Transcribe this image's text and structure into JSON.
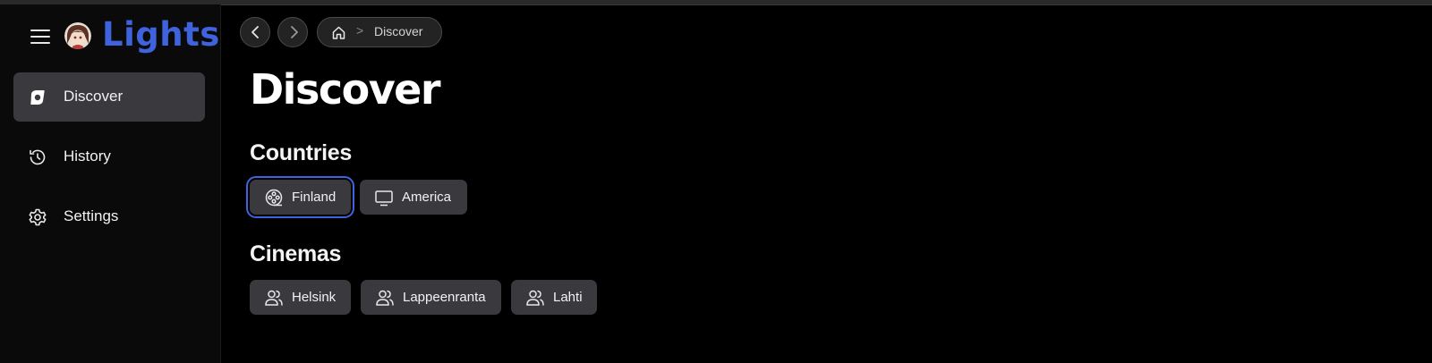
{
  "app": {
    "name": "Lights",
    "brand_color": "#3f63dc"
  },
  "sidebar": {
    "items": [
      {
        "label": "Discover",
        "icon": "compass-icon",
        "active": true
      },
      {
        "label": "History",
        "icon": "history-clock-icon",
        "active": false
      },
      {
        "label": "Settings",
        "icon": "gear-icon",
        "active": false
      }
    ]
  },
  "header": {
    "back_icon": "chevron-left-icon",
    "forward_icon": "chevron-right-icon",
    "breadcrumb": {
      "home_icon": "home-icon",
      "current": "Discover"
    }
  },
  "main": {
    "title": "Discover",
    "sections": [
      {
        "title": "Countries",
        "chips": [
          {
            "label": "Finland",
            "icon": "film-reel-icon",
            "selected": true
          },
          {
            "label": "America",
            "icon": "monitor-icon",
            "selected": false
          }
        ]
      },
      {
        "title": "Cinemas",
        "chips": [
          {
            "label": "Helsink",
            "icon": "users-icon",
            "selected": false
          },
          {
            "label": "Lappeenranta",
            "icon": "users-icon",
            "selected": false
          },
          {
            "label": "Lahti",
            "icon": "users-icon",
            "selected": false
          }
        ]
      }
    ]
  }
}
